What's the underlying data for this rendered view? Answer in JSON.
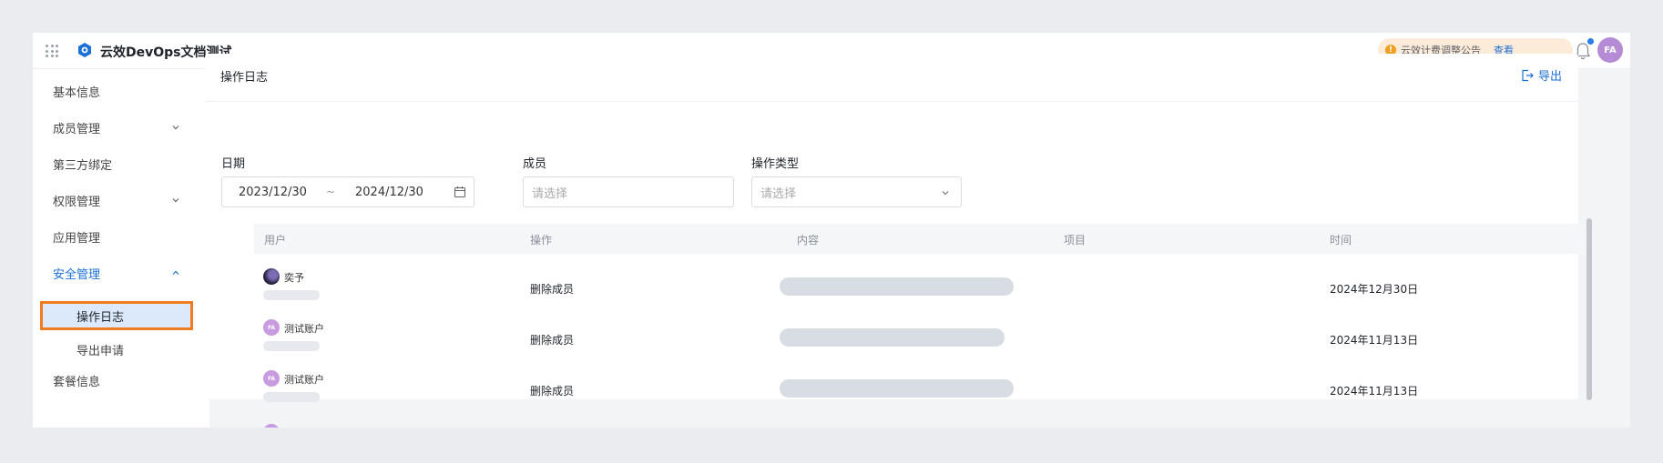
{
  "header": {
    "app_title": "云效DevOps文档测试",
    "notice_text": "云效计费调整公告",
    "notice_link": "查看",
    "avatar_initials": "FA",
    "icons": [
      "apps-grid-icon",
      "devops-logo-icon",
      "bell-icon"
    ]
  },
  "sidebar": {
    "items": [
      {
        "label": "基本信息"
      },
      {
        "label": "成员管理",
        "expandable": true
      },
      {
        "label": "第三方绑定"
      },
      {
        "label": "权限管理",
        "expandable": true
      },
      {
        "label": "应用管理"
      },
      {
        "label": "安全管理",
        "expandable": true,
        "expanded": true
      },
      {
        "label": "套餐信息"
      }
    ],
    "sub_items": [
      {
        "label": "操作日志",
        "selected": true
      },
      {
        "label": "导出申请"
      }
    ]
  },
  "main": {
    "title": "操作日志",
    "export_label": "导出",
    "filters": {
      "date_label": "日期",
      "date_start": "2023/12/30",
      "date_separator": "~",
      "date_end": "2024/12/30",
      "member_label": "成员",
      "member_placeholder": "请选择",
      "type_label": "操作类型",
      "type_placeholder": "请选择"
    },
    "table": {
      "columns": [
        "用户",
        "操作",
        "内容",
        "项目",
        "时间"
      ],
      "rows": [
        {
          "user": "奕予",
          "avatar": "photo",
          "operation": "删除成员",
          "time": "2024年12月30日"
        },
        {
          "user": "测试账户",
          "avatar": "FA",
          "operation": "删除成员",
          "time": "2024年11月13日"
        },
        {
          "user": "测试账户",
          "avatar": "FA",
          "operation": "删除成员",
          "time": "2024年11月13日"
        }
      ]
    }
  },
  "colors": {
    "accent": "#1a6fd8",
    "highlight_outline": "#f07c1f",
    "notice_bg": "#fdebd9",
    "avatar_purple": "#b58bd6"
  }
}
